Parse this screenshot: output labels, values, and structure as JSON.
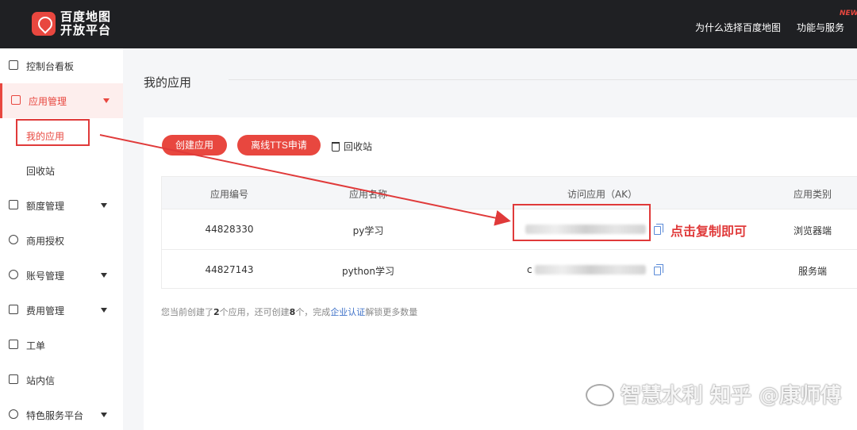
{
  "header": {
    "logo_line1": "百度地图",
    "logo_line2": "开放平台",
    "nav_why": "为什么选择百度地图",
    "nav_func": "功能与服务",
    "nav_badge": "NEW"
  },
  "sidebar": {
    "dashboard": "控制台看板",
    "app_manage": "应用管理",
    "my_apps": "我的应用",
    "recycle_bin": "回收站",
    "quota_manage": "额度管理",
    "commercial_auth": "商用授权",
    "account_manage": "账号管理",
    "billing_manage": "费用管理",
    "ticket": "工单",
    "messages": "站内信",
    "special_services": "特色服务平台"
  },
  "main": {
    "page_title": "我的应用",
    "btn_create": "创建应用",
    "btn_tts": "离线TTS申请",
    "recycle": "回收站",
    "table": {
      "headers": [
        "应用编号",
        "应用名称",
        "访问应用（AK）",
        "应用类别"
      ],
      "rows": [
        {
          "id": "44828330",
          "name": "py学习",
          "type": "浏览器端"
        },
        {
          "id": "44827143",
          "name": "python学习",
          "type": "服务端"
        }
      ]
    },
    "annotation": "点击复制即可",
    "footnote": {
      "pre": "您当前创建了",
      "count1": "2",
      "mid1": "个应用，还可创建",
      "count2": "8",
      "mid2": "个，完成",
      "link": "企业认证",
      "post": "解锁更多数量"
    },
    "ak_prefix": "c"
  },
  "watermark": "智慧水利  知乎 @康师傅"
}
